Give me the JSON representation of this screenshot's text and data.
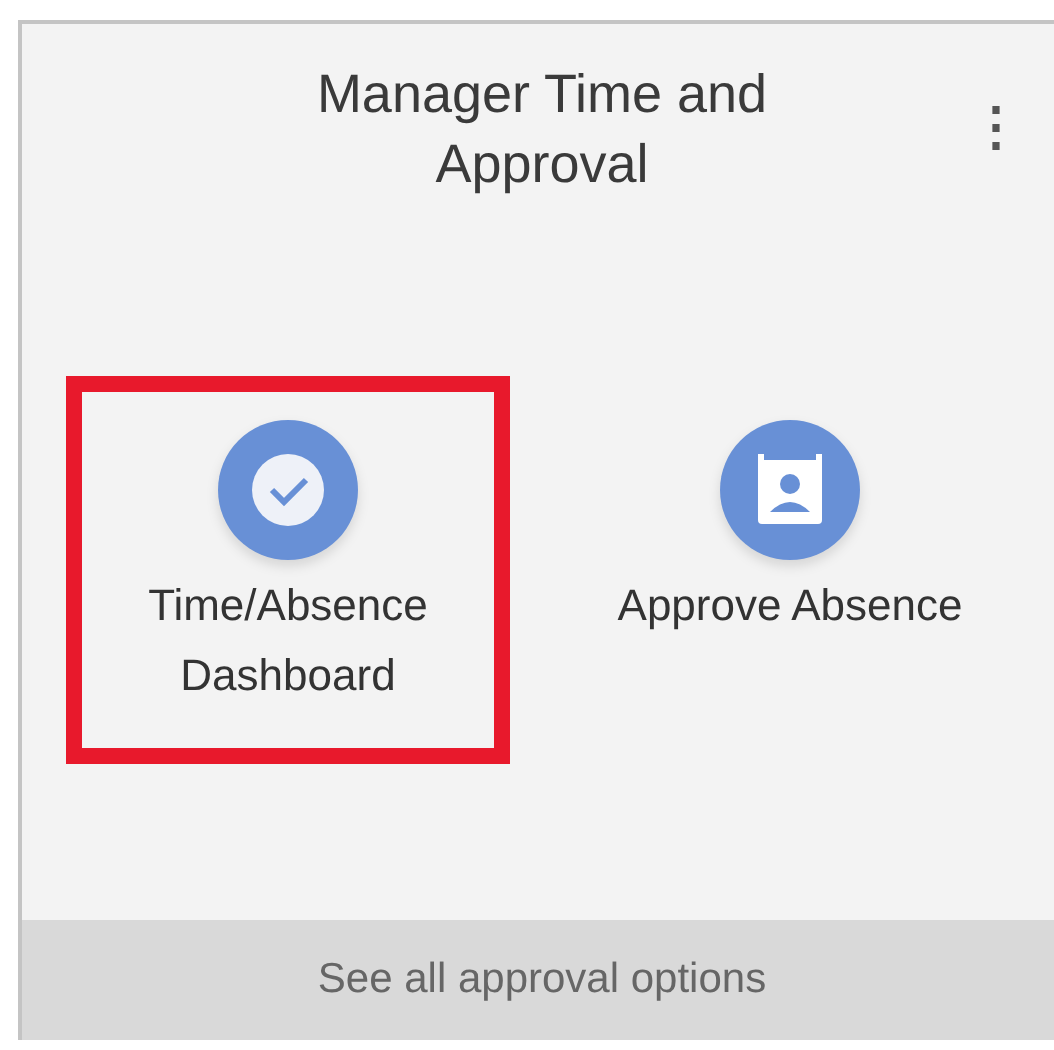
{
  "card": {
    "title": "Manager Time and Approval",
    "menu": "⋮"
  },
  "tiles": [
    {
      "kind": "dashboard",
      "label": "Time/Absence Dashboard",
      "highlighted": true
    },
    {
      "kind": "approve",
      "label": "Approve Absence",
      "highlighted": false
    }
  ],
  "footer": {
    "link": "See all approval options"
  }
}
